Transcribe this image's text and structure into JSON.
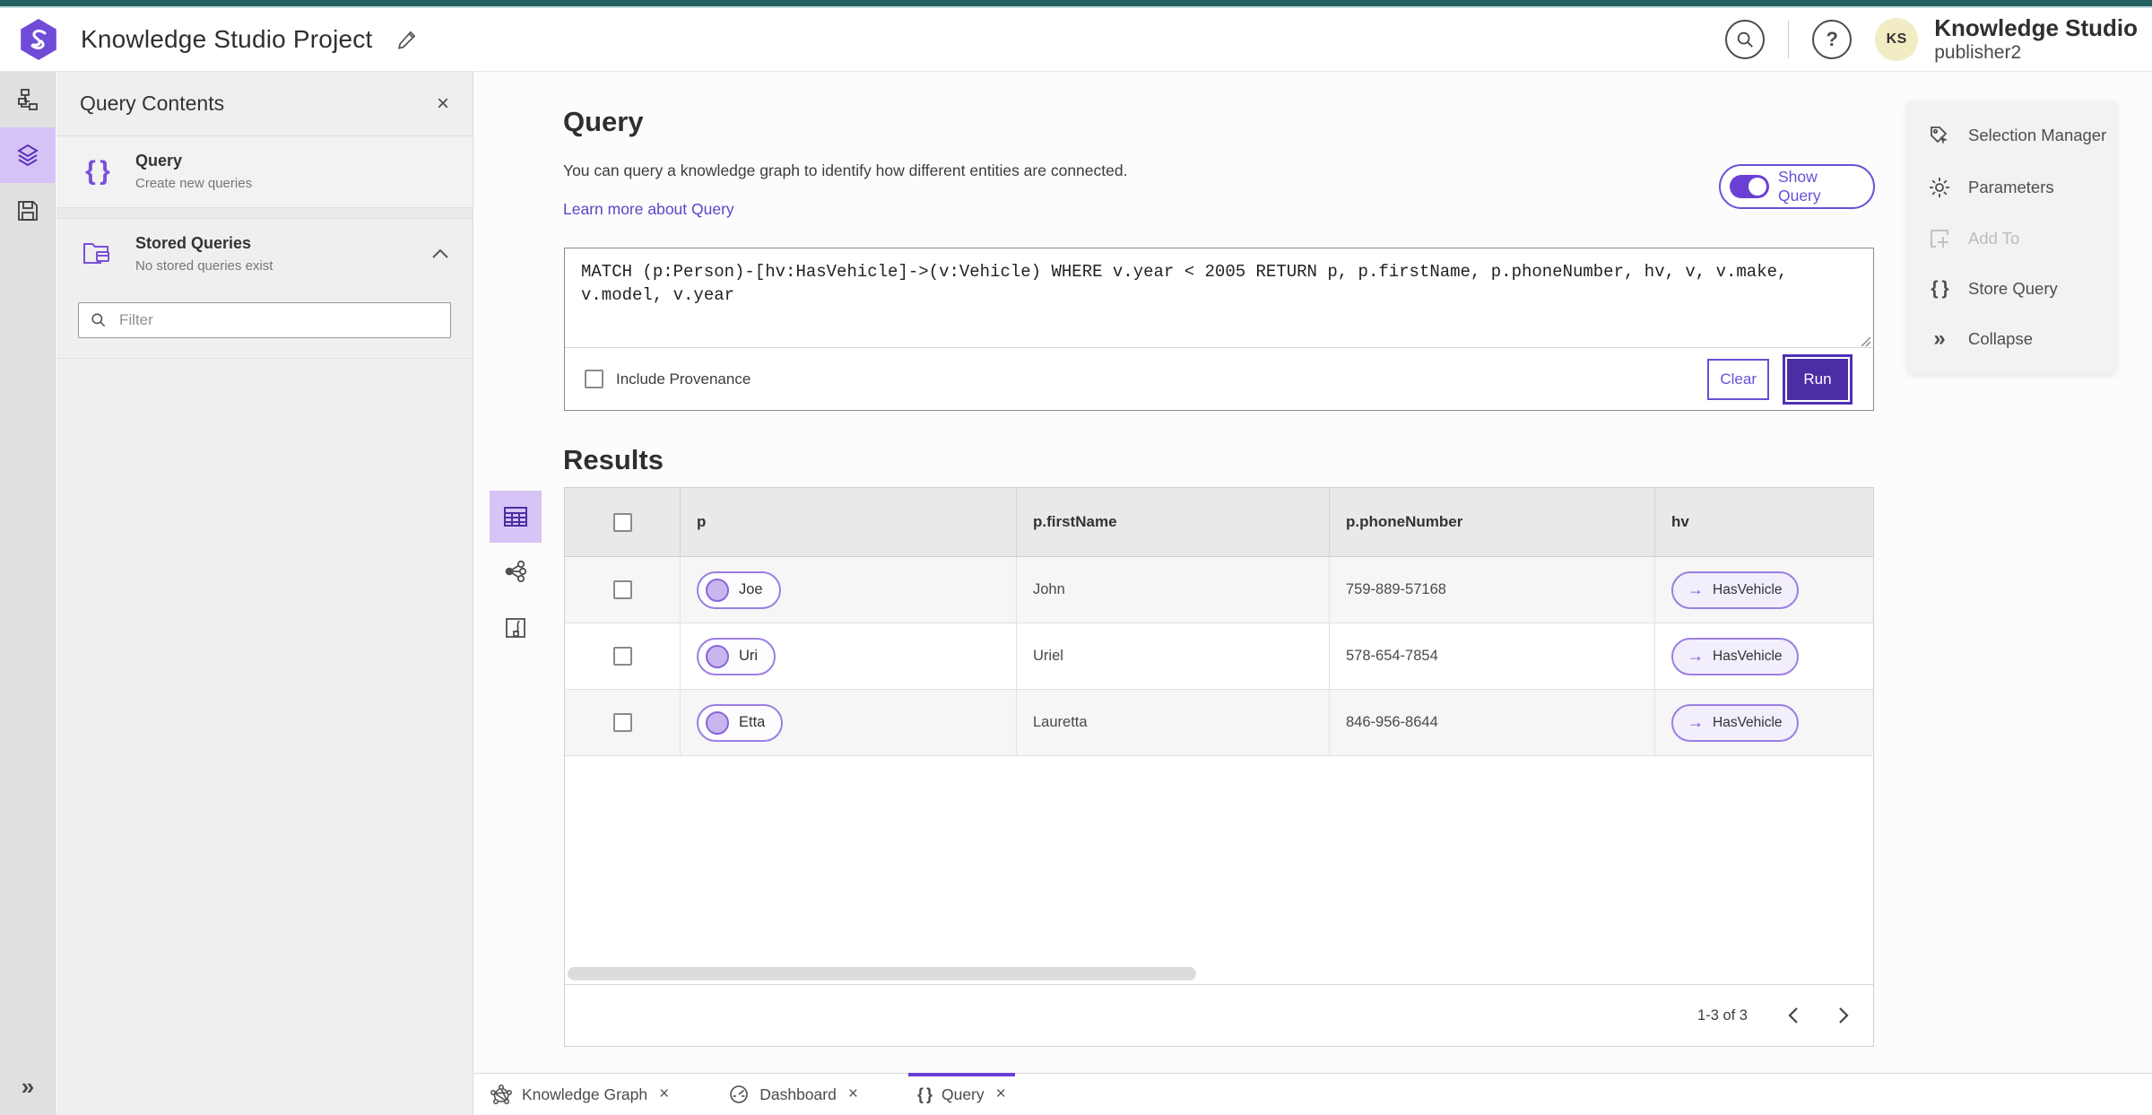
{
  "header": {
    "title": "Knowledge Studio Project",
    "user": {
      "initials": "KS",
      "name": "Knowledge Studio",
      "role": "publisher2"
    }
  },
  "left_panel": {
    "title": "Query Contents",
    "query_item": {
      "title": "Query",
      "subtitle": "Create new queries"
    },
    "stored_queries": {
      "title": "Stored Queries",
      "subtitle": "No stored queries exist"
    },
    "filter_placeholder": "Filter"
  },
  "query_section": {
    "title": "Query",
    "description": "You can query a knowledge graph to identify how different entities are connected.",
    "learn_more": "Learn more about Query",
    "show_query_label": "Show Query",
    "query_text": "MATCH (p:Person)-[hv:HasVehicle]->(v:Vehicle) WHERE v.year < 2005 RETURN p, p.firstName, p.phoneNumber, hv, v, v.make, v.model, v.year",
    "include_provenance_label": "Include Provenance",
    "clear_label": "Clear",
    "run_label": "Run"
  },
  "side_actions": {
    "selection_manager": "Selection Manager",
    "parameters": "Parameters",
    "add_to": "Add To",
    "store_query": "Store Query",
    "collapse": "Collapse"
  },
  "results": {
    "title": "Results",
    "columns": [
      "p",
      "p.firstName",
      "p.phoneNumber",
      "hv"
    ],
    "rows": [
      {
        "node": "Joe",
        "firstName": "John",
        "phoneNumber": "759-889-57168",
        "edge": "HasVehicle"
      },
      {
        "node": "Uri",
        "firstName": "Uriel",
        "phoneNumber": "578-654-7854",
        "edge": "HasVehicle"
      },
      {
        "node": "Etta",
        "firstName": "Lauretta",
        "phoneNumber": "846-956-8644",
        "edge": "HasVehicle"
      }
    ],
    "pagination": {
      "range": "1-3 of 3"
    }
  },
  "tabs": {
    "knowledge_graph": "Knowledge Graph",
    "dashboard": "Dashboard",
    "query": "Query"
  },
  "glyphs": {
    "close": "×",
    "braces": "{ }",
    "help": "?",
    "collapse": "»",
    "edge_arrow": "→"
  },
  "colors": {
    "top_accent": "#215f60",
    "accent_purple": "#6a4fd6",
    "dark_purple": "#4b2da5",
    "selected_rail_bg": "#d6c3f5",
    "table_header_bg": "#e9e9e9",
    "link": "#5a47c6"
  }
}
